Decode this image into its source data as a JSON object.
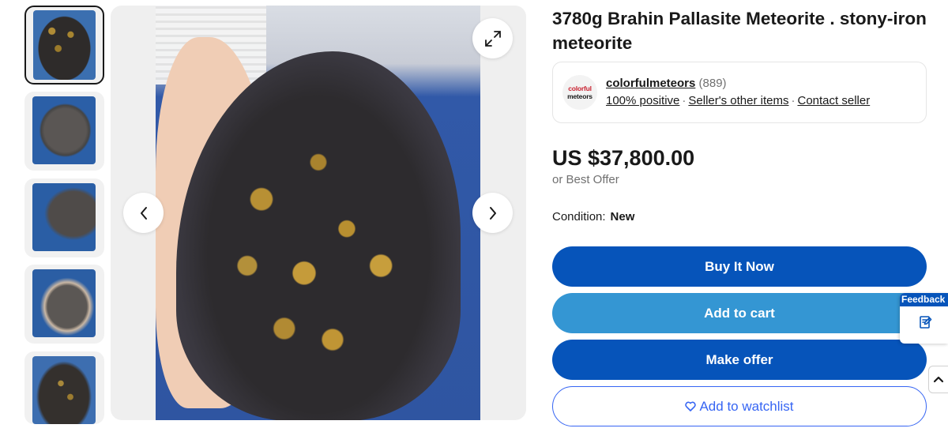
{
  "listing": {
    "title": "3780g Brahin Pallasite Meteorite . stony-iron meteorite"
  },
  "gallery": {
    "thumbnails": [
      {
        "name": "thumb-slab-front",
        "active": true
      },
      {
        "name": "thumb-rock-side"
      },
      {
        "name": "thumb-rock-blue"
      },
      {
        "name": "thumb-rock-hand"
      },
      {
        "name": "thumb-slab-partial"
      }
    ],
    "icons": {
      "expand": "expand-icon",
      "prev": "chevron-left-icon",
      "next": "chevron-right-icon"
    }
  },
  "seller": {
    "logo_line1": "colorful",
    "logo_line2": "meteors",
    "name": "colorfulmeteors",
    "feedback_count": "(889)",
    "positive": "100% positive",
    "other_items": "Seller's other items",
    "contact": "Contact seller",
    "separator": "·"
  },
  "pricing": {
    "price": "US $37,800.00",
    "best_offer": "or Best Offer"
  },
  "condition": {
    "label": "Condition:",
    "value": "New"
  },
  "actions": {
    "buy_now": "Buy It Now",
    "add_to_cart": "Add to cart",
    "make_offer": "Make offer",
    "watchlist": "Add to watchlist"
  },
  "feedback_tab": {
    "label": "Feedback"
  },
  "colors": {
    "primary_blue": "#0654ba",
    "cart_blue": "#3496d3",
    "link_blue": "#3665f3",
    "text": "#191919",
    "muted": "#707070"
  }
}
